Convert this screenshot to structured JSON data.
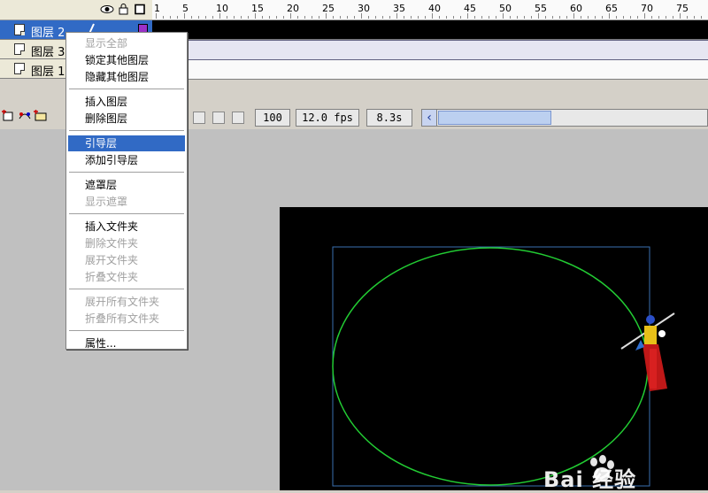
{
  "timeline": {
    "frame_numbers": [
      "1",
      "5",
      "10",
      "15",
      "20",
      "25",
      "30",
      "35",
      "40",
      "45",
      "50",
      "55",
      "60",
      "65",
      "70",
      "75"
    ],
    "header_icons": [
      "eye-icon",
      "lock-icon",
      "outline-square-icon"
    ],
    "layers": [
      {
        "name": "图层 2",
        "selected": true,
        "color": "#9b30c8"
      },
      {
        "name": "图层 3",
        "selected": false
      },
      {
        "name": "图层 1",
        "selected": false
      }
    ],
    "zoom": "100",
    "fps": "12.0 fps",
    "time": "8.3s",
    "scroll_left_glyph": "‹"
  },
  "context_menu": {
    "items": [
      {
        "label": "显示全部",
        "disabled": true
      },
      {
        "label": "锁定其他图层",
        "disabled": false
      },
      {
        "label": "隐藏其他图层",
        "disabled": false
      },
      {
        "label": "插入图层",
        "disabled": false
      },
      {
        "label": "删除图层",
        "disabled": false
      },
      {
        "label": "引导层",
        "disabled": false,
        "highlight": true
      },
      {
        "label": "添加引导层",
        "disabled": false
      },
      {
        "label": "遮罩层",
        "disabled": false
      },
      {
        "label": "显示遮罩",
        "disabled": true
      },
      {
        "label": "插入文件夹",
        "disabled": false
      },
      {
        "label": "删除文件夹",
        "disabled": true
      },
      {
        "label": "展开文件夹",
        "disabled": true
      },
      {
        "label": "折叠文件夹",
        "disabled": true
      },
      {
        "label": "展开所有文件夹",
        "disabled": true
      },
      {
        "label": "折叠所有文件夹",
        "disabled": true
      },
      {
        "label": "属性...",
        "disabled": false
      }
    ]
  },
  "stage": {
    "background": "#000000",
    "guide_ellipse_color": "#22cc33",
    "bounding_box_color": "#3a6fb0"
  },
  "watermark": {
    "text": "Bai 经验"
  },
  "colors": {
    "selection": "#316ac5",
    "panel": "#ece9d8",
    "workarea": "#c0c0c0"
  }
}
